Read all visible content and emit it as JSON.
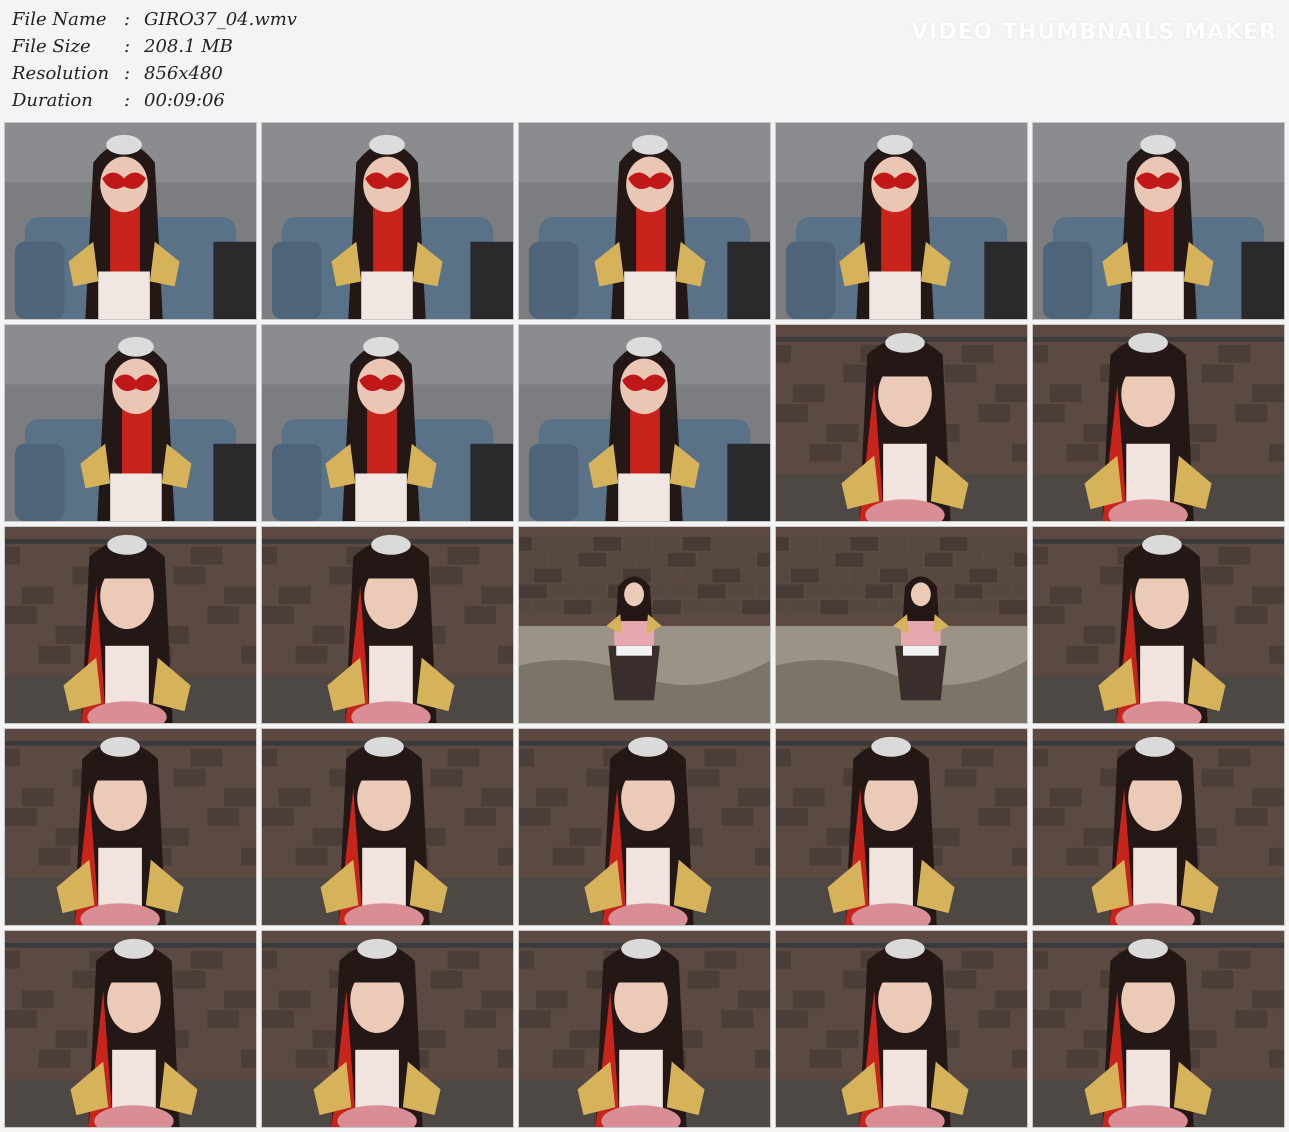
{
  "info": [
    {
      "label": "File Name",
      "sep": ":",
      "value": "GIRO37_04.wmv"
    },
    {
      "label": "File Size",
      "sep": ":",
      "value": "208.1 MB"
    },
    {
      "label": "Resolution",
      "sep": ":",
      "value": "856x480"
    },
    {
      "label": "Duration",
      "sep": ":",
      "value": "00:09:06"
    }
  ],
  "watermark": "VIDEO THUMBNAILS MAKER",
  "colors": {
    "background": "#f4f4f4",
    "sofa": "#5a7288",
    "wall_gray": "#7b7d80",
    "brick": "#5c4a42",
    "floor": "#9a9386",
    "costume_red": "#c8241c",
    "armor_gold": "#d6b25a",
    "hair": "#241817",
    "mask_red": "#c01818"
  },
  "thumbnails": [
    {
      "scene": "sofa-mask-closeup"
    },
    {
      "scene": "sofa-mask-closeup"
    },
    {
      "scene": "sofa-mask-closeup"
    },
    {
      "scene": "sofa-mask-closeup"
    },
    {
      "scene": "sofa-mask-closeup"
    },
    {
      "scene": "sofa-mask-closeup"
    },
    {
      "scene": "sofa-mask-closeup"
    },
    {
      "scene": "sofa-mask-closeup"
    },
    {
      "scene": "brick-closeup"
    },
    {
      "scene": "brick-closeup"
    },
    {
      "scene": "brick-closeup"
    },
    {
      "scene": "brick-closeup"
    },
    {
      "scene": "brick-wide-sitting"
    },
    {
      "scene": "brick-wide-sitting"
    },
    {
      "scene": "brick-closeup"
    },
    {
      "scene": "brick-closeup"
    },
    {
      "scene": "brick-closeup"
    },
    {
      "scene": "brick-closeup"
    },
    {
      "scene": "brick-closeup"
    },
    {
      "scene": "brick-closeup"
    },
    {
      "scene": "brick-closeup"
    },
    {
      "scene": "brick-closeup"
    },
    {
      "scene": "brick-closeup"
    },
    {
      "scene": "brick-closeup"
    },
    {
      "scene": "brick-closeup"
    }
  ]
}
